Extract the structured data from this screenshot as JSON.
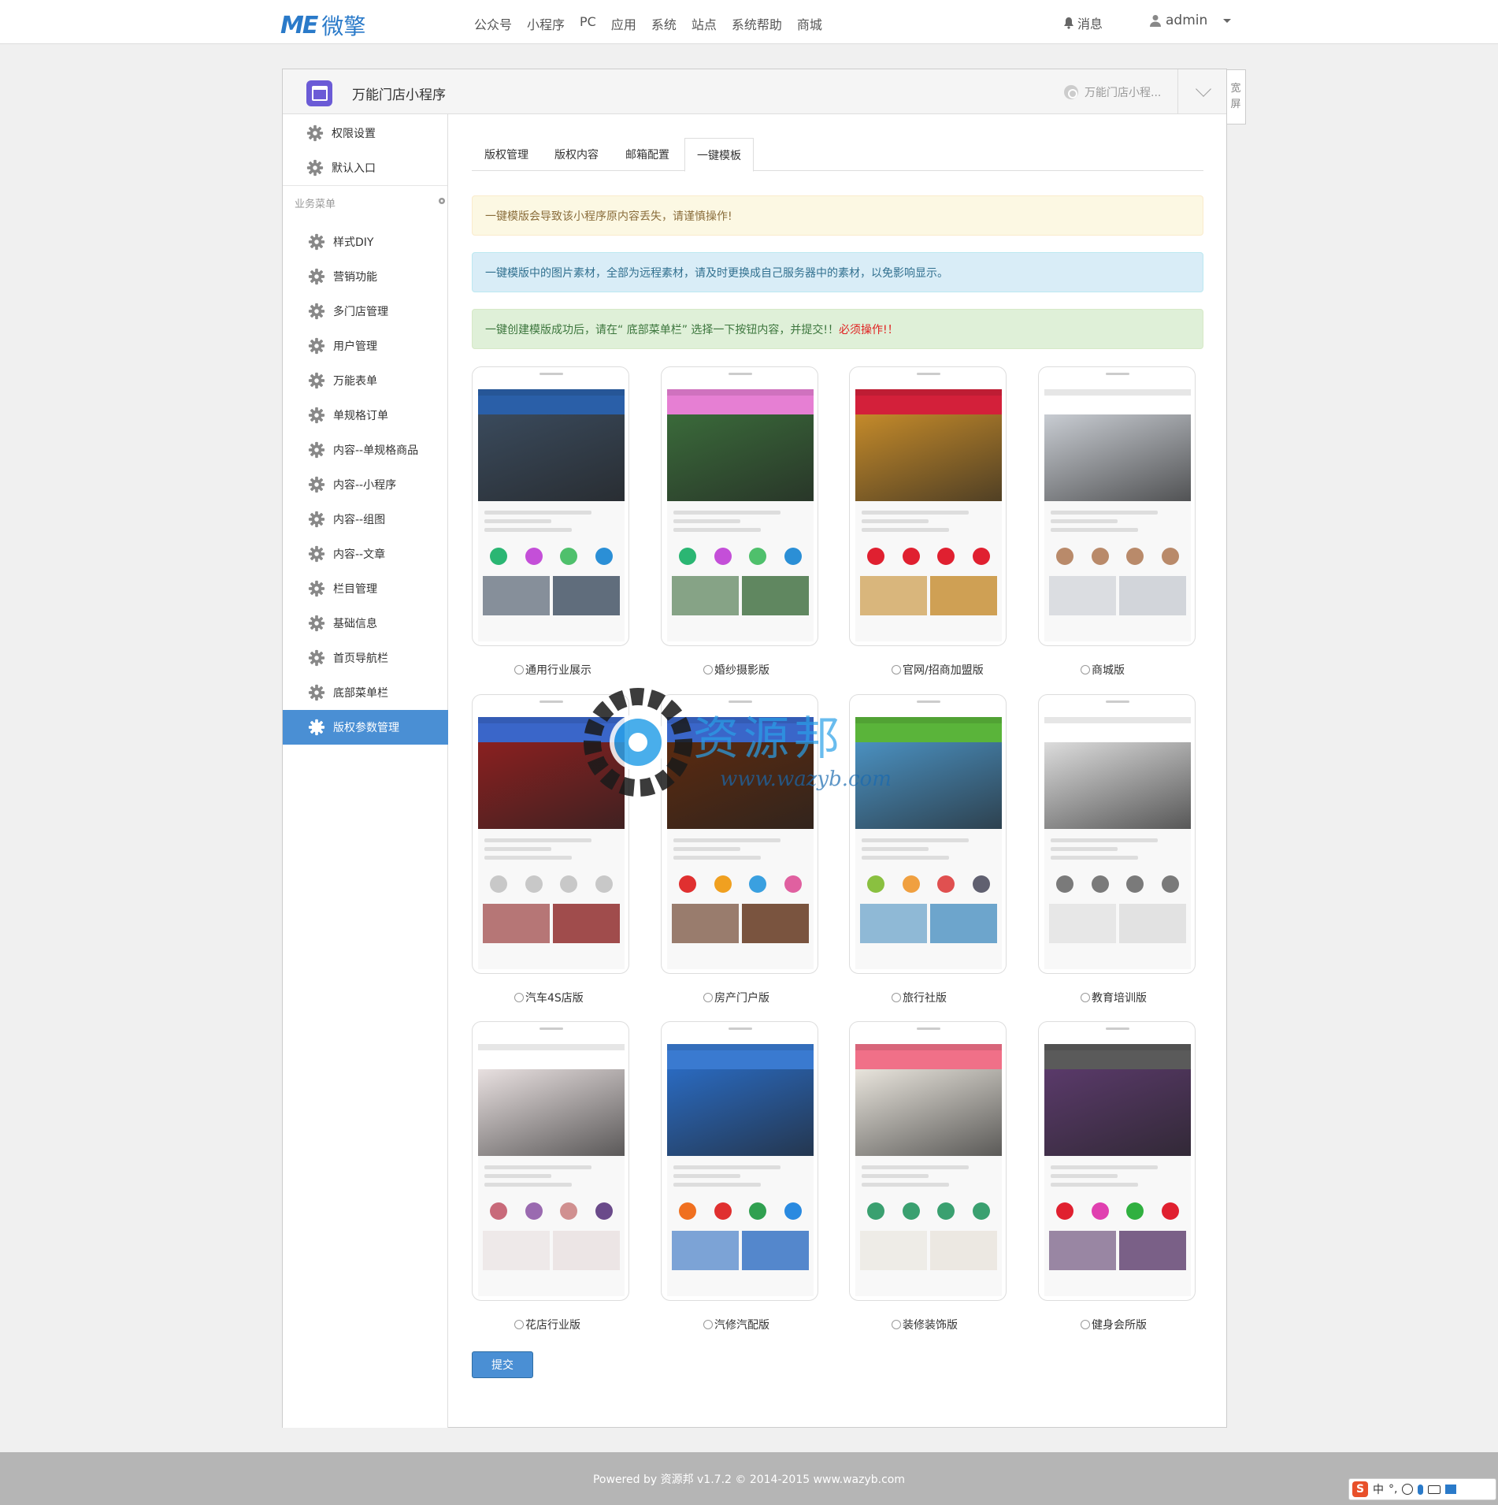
{
  "header": {
    "logo_mark": "ME",
    "logo_name": "微擎",
    "nav": [
      "公众号",
      "小程序",
      "PC",
      "应用",
      "系统",
      "站点",
      "系统帮助",
      "商城"
    ],
    "messages_label": "消息",
    "user_name": "admin"
  },
  "app": {
    "title": "万能门店小程序",
    "switch_label": "万能门店小程...",
    "wide_label_1": "宽",
    "wide_label_2": "屏"
  },
  "sidebar": {
    "top_items": [
      "权限设置",
      "默认入口"
    ],
    "section_label": "业务菜单",
    "items": [
      "样式DIY",
      "营销功能",
      "多门店管理",
      "用户管理",
      "万能表单",
      "单规格订单",
      "内容--单规格商品",
      "内容--小程序",
      "内容--组图",
      "内容--文章",
      "栏目管理",
      "基础信息",
      "首页导航栏",
      "底部菜单栏",
      "版权参数管理"
    ],
    "active_index": 14
  },
  "tabs": [
    "版权管理",
    "版权内容",
    "邮箱配置",
    "一键模板"
  ],
  "active_tab": 3,
  "alerts": {
    "warning": "一键模版会导致该小程序原内容丢失，请谨慎操作!",
    "info": "一键模版中的图片素材，全部为远程素材，请及时更换成自己服务器中的素材，以免影响显示。",
    "success_main": "一键创建模版成功后，请在“ 底部菜单栏” 选择一下按钮内容，并提交!！",
    "success_red": "必须操作!！"
  },
  "templates": [
    {
      "label": "通用行业展示",
      "color": "#2a5fa8",
      "hero": "#3a4a5c",
      "icons": [
        "#2bb673",
        "#c44fd8",
        "#4fc06c",
        "#2b8fd6"
      ]
    },
    {
      "label": "婚纱摄影版",
      "color": "#e67fd3",
      "hero": "#3a6a3a",
      "icons": [
        "#2bb673",
        "#c44fd8",
        "#4fc06c",
        "#2b8fd6"
      ]
    },
    {
      "label": "官网/招商加盟版",
      "color": "#d3203a",
      "hero": "#c48a2a",
      "icons": [
        "#e02030",
        "#e02030",
        "#e02030",
        "#e02030"
      ]
    },
    {
      "label": "商城版",
      "color": "#ffffff",
      "hero": "#c8ccd2",
      "icons": [
        "#b98a6a",
        "#b98a6a",
        "#b98a6a",
        "#b98a6a"
      ]
    },
    {
      "label": "汽车4S店版",
      "color": "#3a66c9",
      "hero": "#8a2020",
      "icons": [
        "#c8c8c8",
        "#c8c8c8",
        "#c8c8c8",
        "#c8c8c8"
      ]
    },
    {
      "label": "房产门户版",
      "color": "#3a66c9",
      "hero": "#5a2a10",
      "icons": [
        "#e03030",
        "#f0a020",
        "#3aa0e0",
        "#e060a0"
      ]
    },
    {
      "label": "旅行社版",
      "color": "#5ab43a",
      "hero": "#4a90c0",
      "icons": [
        "#8ac040",
        "#f0a040",
        "#e05050",
        "#606070"
      ]
    },
    {
      "label": "教育培训版",
      "color": "#ffffff",
      "hero": "#dcdcdc",
      "icons": [
        "#7a7a7a",
        "#7a7a7a",
        "#7a7a7a",
        "#7a7a7a"
      ]
    },
    {
      "label": "花店行业版",
      "color": "#ffffff",
      "hero": "#e8e0e0",
      "icons": [
        "#c86a7a",
        "#9a6ab0",
        "#d09090",
        "#6a4a8a"
      ]
    },
    {
      "label": "汽修汽配版",
      "color": "#3a7ad0",
      "hero": "#2a6ac0",
      "icons": [
        "#f07020",
        "#e03030",
        "#30a050",
        "#2a8ae0"
      ]
    },
    {
      "label": "装修装饰版",
      "color": "#f07088",
      "hero": "#e8e4dc",
      "icons": [
        "#3aa070",
        "#3aa070",
        "#3aa070",
        "#3aa070"
      ]
    },
    {
      "label": "健身会所版",
      "color": "#5a5a5a",
      "hero": "#5a3a6a",
      "icons": [
        "#e02030",
        "#e040b0",
        "#30b040",
        "#e02030"
      ]
    }
  ],
  "submit_label": "提交",
  "footer": "Powered by 资源邦 v1.7.2 © 2014-2015 www.wazyb.com",
  "watermark": {
    "line1": "资源邦",
    "line2": "www.wazyb.com"
  },
  "ime": {
    "lang": "中",
    "logo": "S"
  }
}
